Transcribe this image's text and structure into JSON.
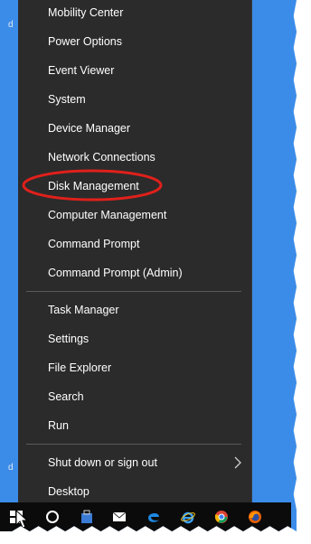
{
  "menu": {
    "items_group1": [
      {
        "label": "Mobility Center"
      },
      {
        "label": "Power Options"
      },
      {
        "label": "Event Viewer"
      },
      {
        "label": "System"
      },
      {
        "label": "Device Manager"
      },
      {
        "label": "Network Connections"
      },
      {
        "label": "Disk Management"
      },
      {
        "label": "Computer Management"
      },
      {
        "label": "Command Prompt"
      },
      {
        "label": "Command Prompt (Admin)"
      }
    ],
    "items_group2": [
      {
        "label": "Task Manager"
      },
      {
        "label": "Settings"
      },
      {
        "label": "File Explorer"
      },
      {
        "label": "Search"
      },
      {
        "label": "Run"
      }
    ],
    "items_group3": [
      {
        "label": "Shut down or sign out"
      },
      {
        "label": "Desktop"
      }
    ],
    "highlighted_item": "Disk Management"
  },
  "desktop": {
    "edge_chars": [
      "d",
      "d"
    ]
  },
  "taskbar": {
    "icons": [
      "start-icon",
      "cortana-icon",
      "store-icon",
      "mail-icon",
      "edge-icon",
      "ie-icon",
      "chrome-icon",
      "firefox-icon"
    ]
  },
  "colors": {
    "menu_bg": "#2b2b2b",
    "desktop_blue": "#3b8ce9",
    "taskbar": "#0b0b0b",
    "annotation_ring": "#e0201b"
  }
}
